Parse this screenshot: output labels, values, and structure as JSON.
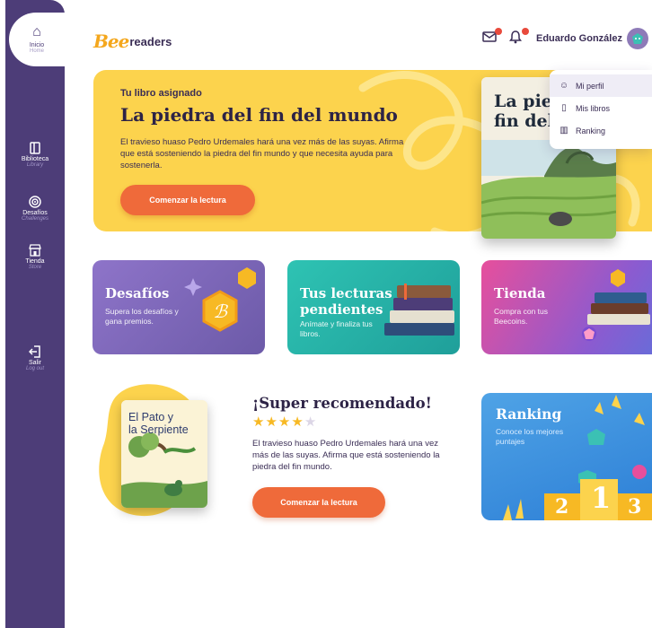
{
  "sidebar": {
    "home": {
      "label": "Inicio",
      "sub": "Home"
    },
    "items": [
      {
        "label": "Biblioteca",
        "sub": "Library"
      },
      {
        "label": "Desafíos",
        "sub": "Challenges"
      },
      {
        "label": "Tienda",
        "sub": "Store"
      },
      {
        "label": "Salir",
        "sub": "Log out"
      }
    ]
  },
  "header": {
    "logo_mark": "Bee",
    "logo_text": "readers",
    "user_name": "Eduardo González"
  },
  "dropdown": {
    "items": [
      {
        "label": "Mi perfil",
        "icon": "profile-icon"
      },
      {
        "label": "Mis libros",
        "icon": "book-open-icon"
      },
      {
        "label": "Ranking",
        "icon": "ranking-icon"
      }
    ]
  },
  "hero": {
    "label": "Tu libro asignado",
    "title": "La piedra del fin del mundo",
    "description": "El travieso huaso Pedro Urdemales hará una vez más de las suyas. Afirma que está sosteniendo la piedra del fin mundo y que necesita ayuda para sostenerla.",
    "button": "Comenzar la lectura",
    "cover_title": "La piedra del\nfin del mundo"
  },
  "cards": [
    {
      "title": "Desafíos",
      "desc": "Supera los desafíos y gana premios."
    },
    {
      "title": "Tus lecturas\npendientes",
      "desc": "Anímate y finaliza tus libros."
    },
    {
      "title": "Tienda",
      "desc": "Compra con tus Beecoins."
    }
  ],
  "recommended": {
    "title": "¡Super recomendado!",
    "rating": 4,
    "max_rating": 5,
    "description": "El travieso huaso Pedro Urdemales hará una vez más de las suyas. Afirma que está sosteniendo la piedra del fin mundo.",
    "button": "Comenzar la lectura",
    "cover_title": "El Pato y\nla Serpiente"
  },
  "ranking": {
    "title": "Ranking",
    "desc": "Conoce los mejores puntajes",
    "podium": [
      "2",
      "1",
      "3"
    ]
  },
  "colors": {
    "sidebar": "#4d3d78",
    "hero": "#fcd34d",
    "button": "#ef6a3a",
    "challenges_card": "#7a64b8",
    "pending_card": "#27b3a8",
    "store_card": "#b857b8",
    "ranking_card": "#3a8fdf"
  }
}
